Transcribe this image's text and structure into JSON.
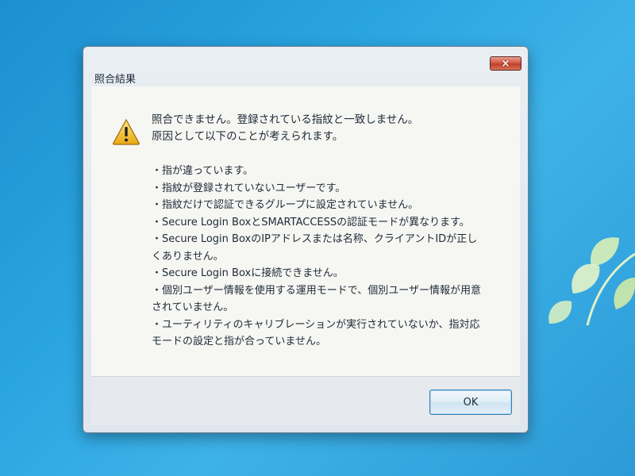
{
  "dialog": {
    "title": "照合結果",
    "close_label": "×",
    "heading_line1": "照合できません。登録されている指紋と一致しません。",
    "heading_line2": "原因として以下のことが考えられます。",
    "reasons": [
      "・指が違っています。",
      "・指紋が登録されていないユーザーです。",
      "・指紋だけで認証できるグループに設定されていません。",
      "・Secure Login BoxとSMARTACCESSの認証モードが異なります。",
      "・Secure Login BoxのIPアドレスまたは名称、クライアントIDが正しくありません。",
      "・Secure Login Boxに接続できません。",
      "・個別ユーザー情報を使用する運用モードで、個別ユーザー情報が用意されていません。",
      "・ユーティリティのキャリブレーションが実行されていないか、指対応モードの設定と指が合っていません。"
    ],
    "ok_label": "OK"
  },
  "icons": {
    "warning": "warning-icon",
    "close": "close-icon",
    "cursor": "mouse-cursor-icon"
  },
  "colors": {
    "desktop_background": "#2aa4e0",
    "warning_fill": "#f3c22a",
    "close_button": "#c0402a"
  }
}
